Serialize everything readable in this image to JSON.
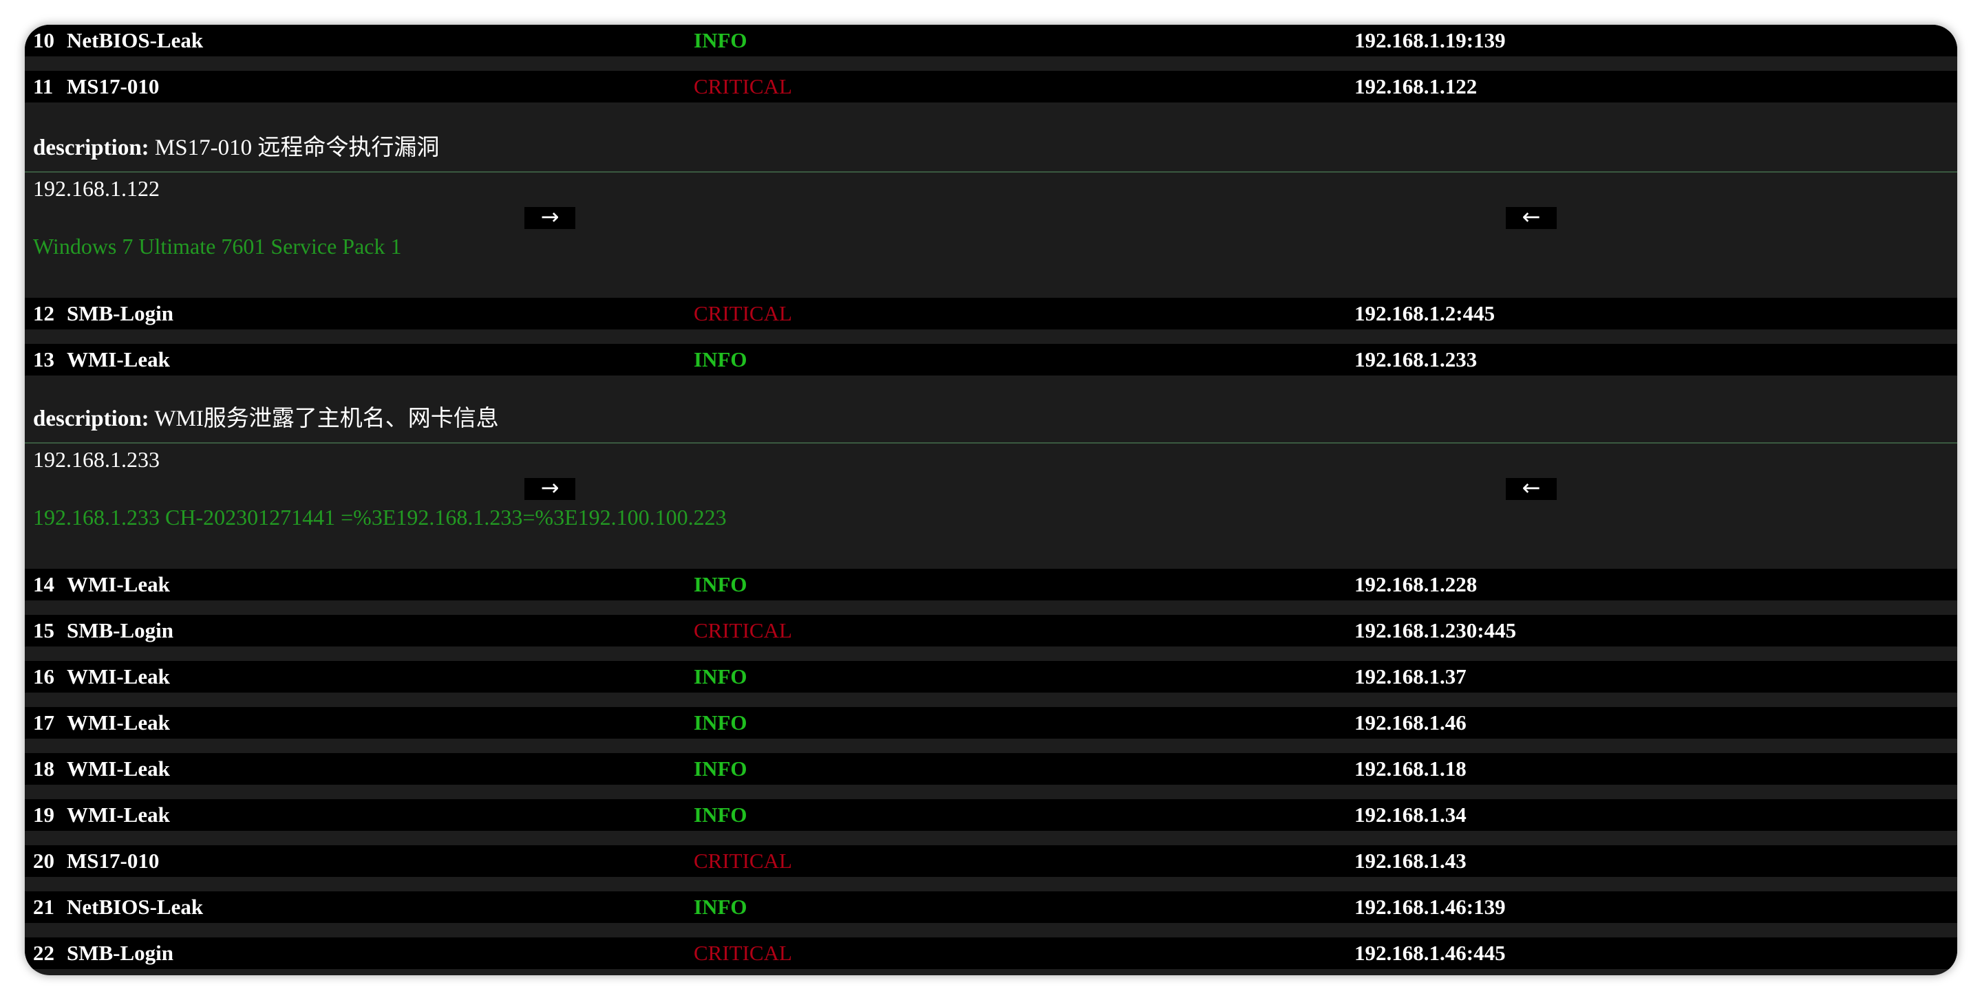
{
  "rows_before": [
    {
      "id": "10",
      "name": "NetBIOS-Leak",
      "severity": "INFO",
      "target": "192.168.1.19:139"
    },
    {
      "id": "11",
      "name": "MS17-010",
      "severity": "CRITICAL",
      "target": "192.168.1.122"
    }
  ],
  "details": [
    {
      "desc_label": "description:",
      "desc_text": " MS17-010 远程命令执行漏洞",
      "host": "192.168.1.122",
      "info": "Windows 7 Ultimate 7601 Service Pack 1",
      "prev_arrow": "→",
      "next_arrow": "←"
    },
    {
      "desc_label": "description:",
      "desc_text": " WMI服务泄露了主机名、网卡信息",
      "host": "192.168.1.233",
      "info": "192.168.1.233 CH-202301271441 =%3E192.168.1.233=%3E192.100.100.223",
      "prev_arrow": "→",
      "next_arrow": "←"
    }
  ],
  "rows_middle": [
    {
      "id": "12",
      "name": "SMB-Login",
      "severity": "CRITICAL",
      "target": "192.168.1.2:445"
    },
    {
      "id": "13",
      "name": "WMI-Leak",
      "severity": "INFO",
      "target": "192.168.1.233"
    }
  ],
  "rows_after": [
    {
      "id": "14",
      "name": "WMI-Leak",
      "severity": "INFO",
      "target": "192.168.1.228"
    },
    {
      "id": "15",
      "name": "SMB-Login",
      "severity": "CRITICAL",
      "target": "192.168.1.230:445"
    },
    {
      "id": "16",
      "name": "WMI-Leak",
      "severity": "INFO",
      "target": "192.168.1.37"
    },
    {
      "id": "17",
      "name": "WMI-Leak",
      "severity": "INFO",
      "target": "192.168.1.46"
    },
    {
      "id": "18",
      "name": "WMI-Leak",
      "severity": "INFO",
      "target": "192.168.1.18"
    },
    {
      "id": "19",
      "name": "WMI-Leak",
      "severity": "INFO",
      "target": "192.168.1.34"
    },
    {
      "id": "20",
      "name": "MS17-010",
      "severity": "CRITICAL",
      "target": "192.168.1.43"
    },
    {
      "id": "21",
      "name": "NetBIOS-Leak",
      "severity": "INFO",
      "target": "192.168.1.46:139"
    },
    {
      "id": "22",
      "name": "SMB-Login",
      "severity": "CRITICAL",
      "target": "192.168.1.46:445"
    }
  ],
  "colors": {
    "info": "#1fbf1f",
    "critical": "#b00015",
    "detail_info": "#229a22",
    "row_bg": "#000000",
    "panel_bg": "#1c1c1c"
  }
}
